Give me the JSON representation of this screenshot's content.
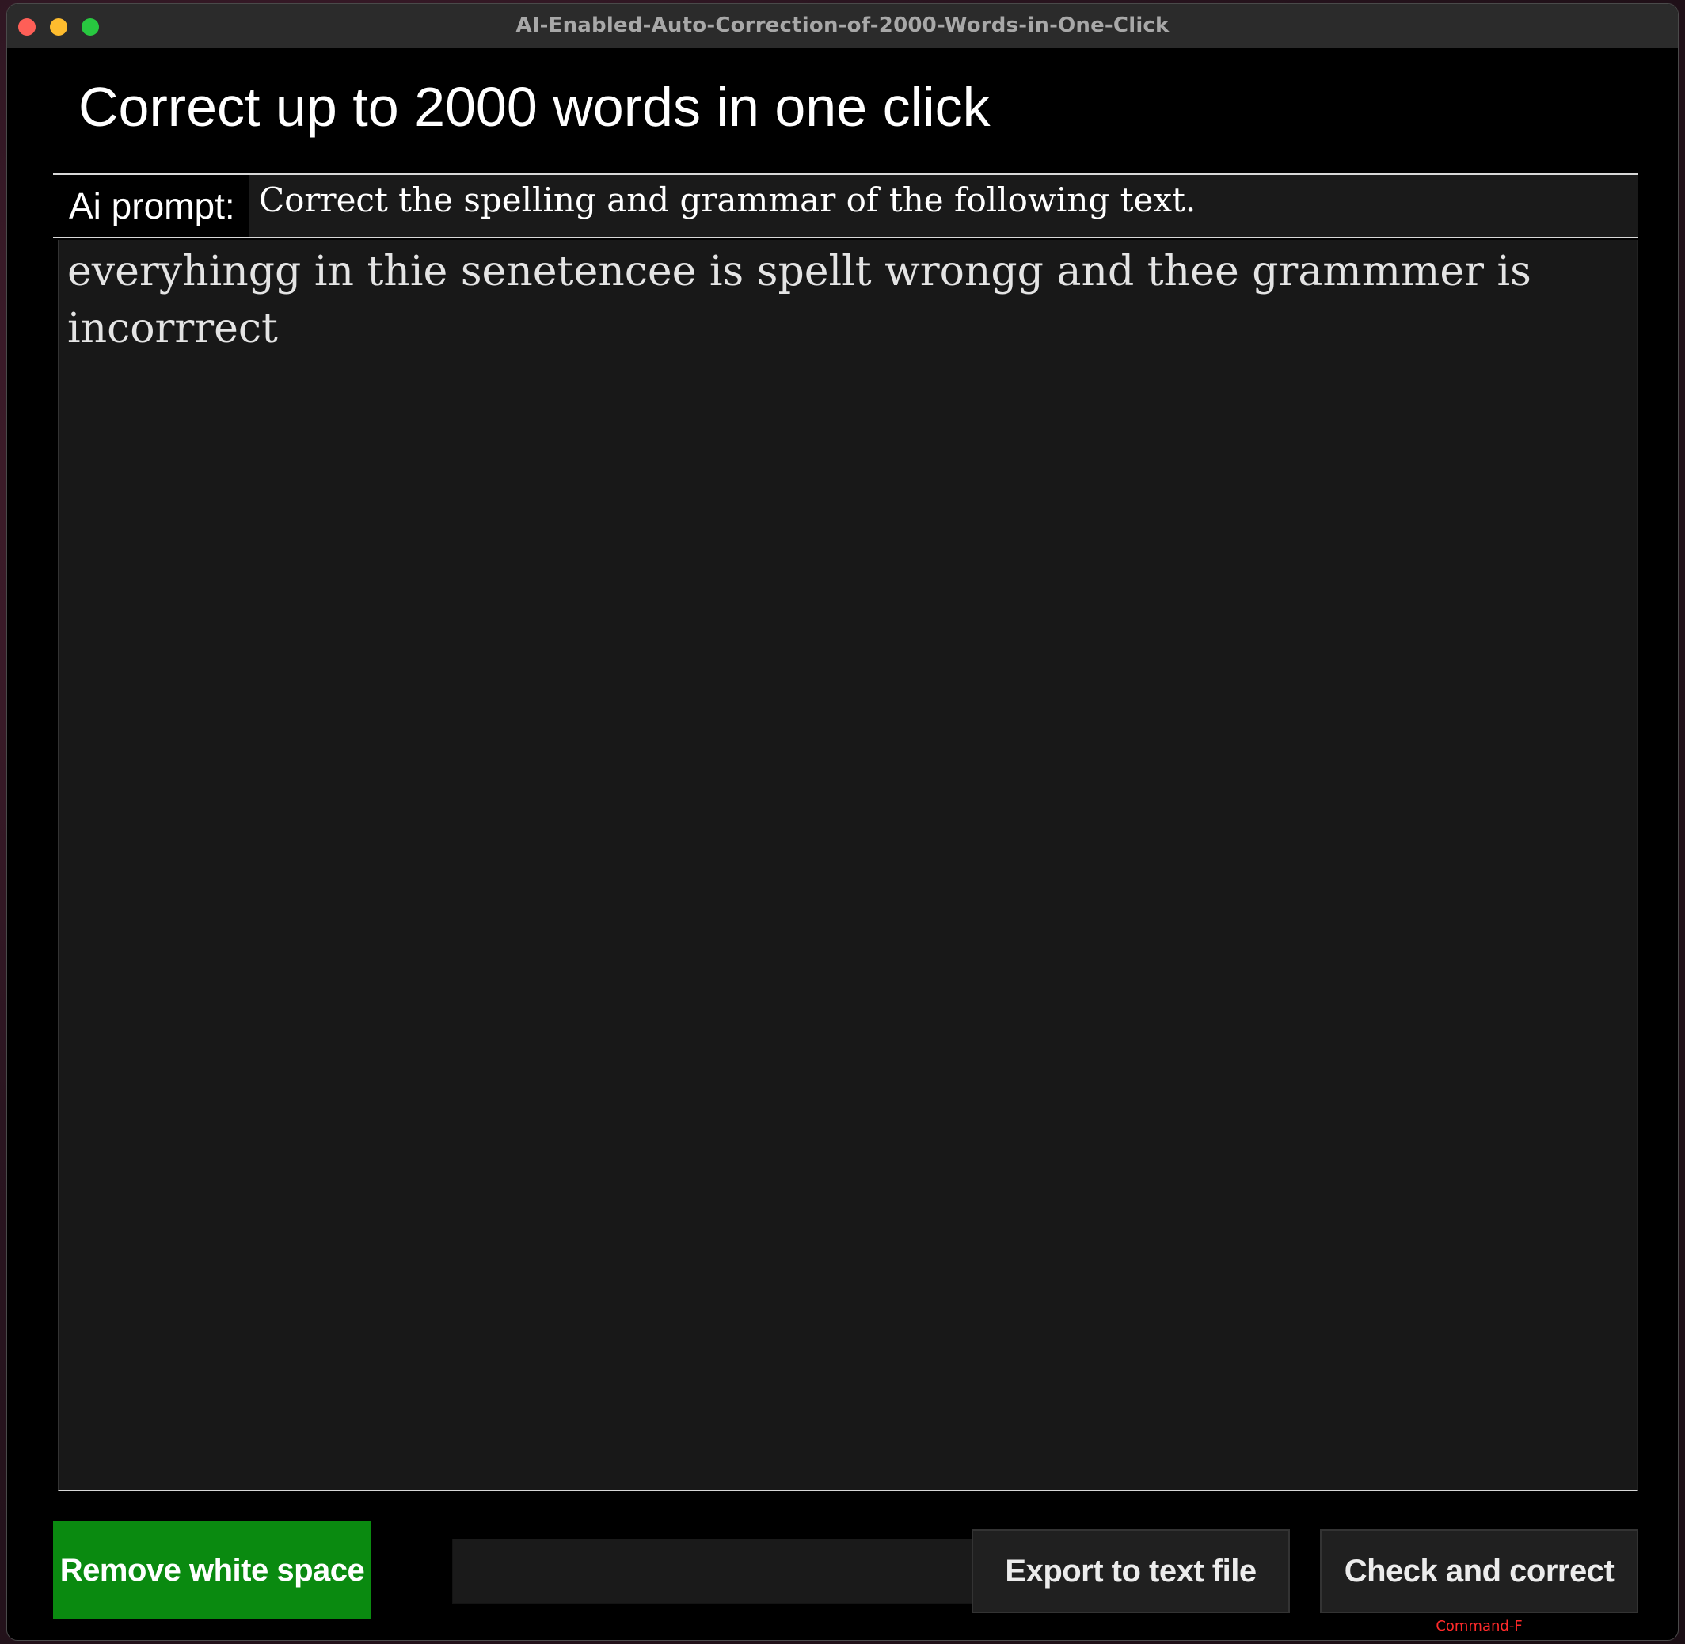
{
  "window": {
    "title": "AI-Enabled-Auto-Correction-of-2000-Words-in-One-Click"
  },
  "heading": "Correct up to 2000 words in one click",
  "prompt": {
    "label": "Ai prompt:",
    "value": "Correct the spelling and grammar of the following text."
  },
  "editor": {
    "text": "everyhingg in thie senetencee is spellt wrongg and thee grammmer is incorrrect"
  },
  "buttons": {
    "remove_whitespace": "Remove white space",
    "export": "Export to text file",
    "check": "Check and correct"
  },
  "file_field": {
    "value": ""
  },
  "shortcut": "Command-F",
  "colors": {
    "remove_button": "#0a8a10",
    "shortcut_text": "#ff2a2a"
  }
}
